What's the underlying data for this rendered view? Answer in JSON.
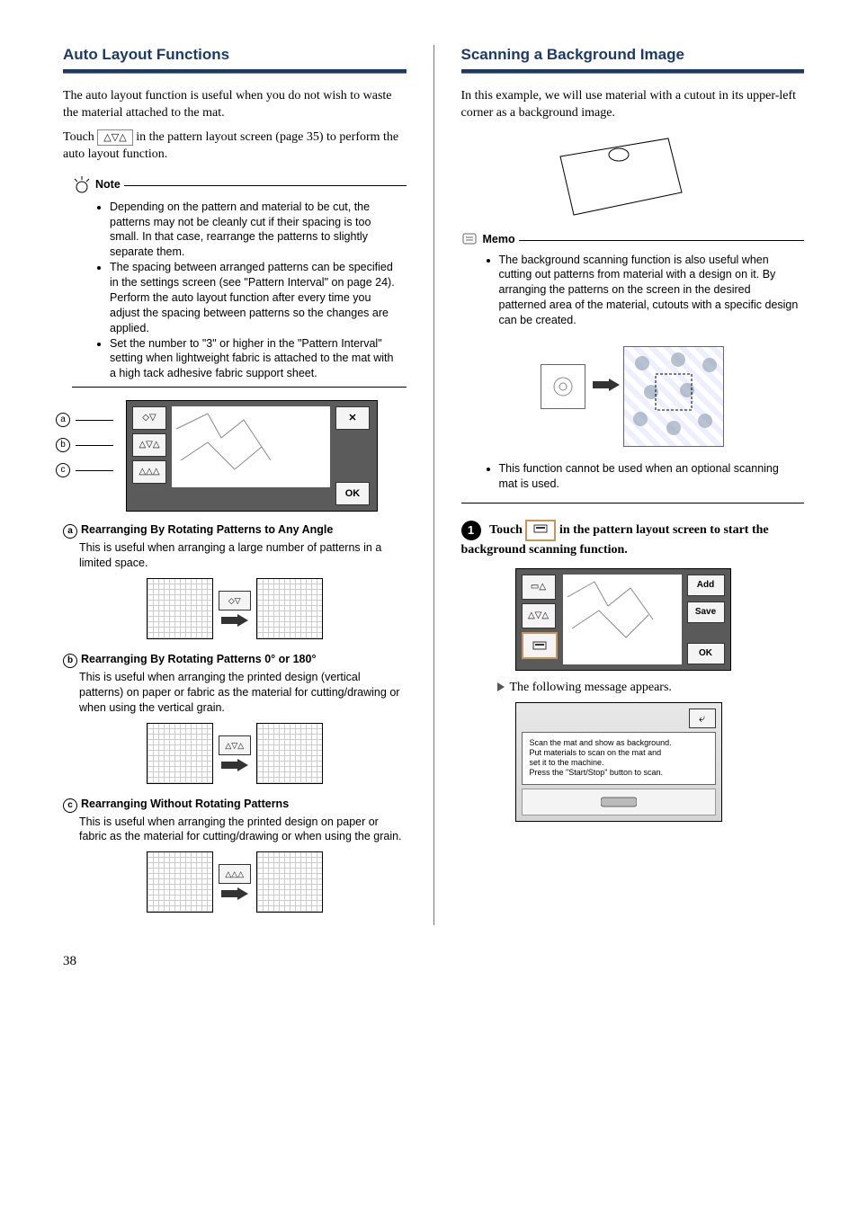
{
  "page_number": "38",
  "left": {
    "title": "Auto Layout Functions",
    "intro_1": "The auto layout function is useful when you do not wish to waste the material attached to the mat.",
    "touch_pre": "Touch ",
    "touch_icon_glyph": "△▽△",
    "touch_post": " in the pattern layout screen (page 35) to perform the auto layout function.",
    "note_label": "Note",
    "notes": [
      "Depending on the pattern and material to be cut, the patterns may not be cleanly cut if their spacing is too small. In that case, rearrange the patterns to slightly separate them.",
      "The spacing between arranged patterns can be specified in the settings screen (see \"Pattern Interval\" on page 24). Perform the auto layout function after every time you adjust the spacing between patterns so the changes are applied.",
      "Set the number to \"3\" or higher in the \"Pattern Interval\" setting when lightweight fabric is attached to the mat with a high tack adhesive fabric support sheet."
    ],
    "screenshot_icons": {
      "row1_glyph": "◇▽",
      "row2_glyph": "△▽△",
      "row3_glyph": "△△△",
      "x_label": "✕",
      "ok_label": "OK"
    },
    "items": {
      "i1_head": "Rearranging By Rotating Patterns to Any Angle",
      "i1_body": "This is useful when arranging a large number of patterns in a limited space.",
      "i1_icon": "◇▽",
      "i2_head": "Rearranging By Rotating Patterns 0° or 180°",
      "i2_body": "This is useful when arranging the printed design (vertical patterns) on paper or fabric as the material for cutting/drawing or when using the vertical grain.",
      "i2_icon": "△▽△",
      "i3_head": "Rearranging Without Rotating Patterns",
      "i3_body": "This is useful when arranging the printed design on paper or fabric as the material for cutting/drawing or when using the grain.",
      "i3_icon": "△△△"
    },
    "circled_1": "a",
    "circled_2": "b",
    "circled_3": "c"
  },
  "right": {
    "title": "Scanning a Background Image",
    "intro": "In this example, we will use material with a cutout in its upper-left corner as a background image.",
    "memo_label": "Memo",
    "memo_items": [
      "The background scanning function is also useful when cutting out patterns from material with a design on it. By arranging the patterns on the screen in the desired patterned area of the material, cutouts with a specific design can be created."
    ],
    "memo_note2": "This function cannot be used when an optional scanning mat is used.",
    "step1_pre": "Touch ",
    "step1_icon": "▭",
    "step1_post": " in the pattern layout screen to start the background scanning function.",
    "ss2": {
      "add": "Add",
      "save": "Save",
      "ok": "OK",
      "left1": "▭△",
      "left2": "△▽△",
      "left3": "▭"
    },
    "following": "The following message appears.",
    "msg_text": "Scan the mat and show as background.\nPut materials to scan on the mat and\nset it to the machine.\nPress the \"Start/Stop\" button to scan.",
    "msg_back_glyph": "⤶"
  }
}
